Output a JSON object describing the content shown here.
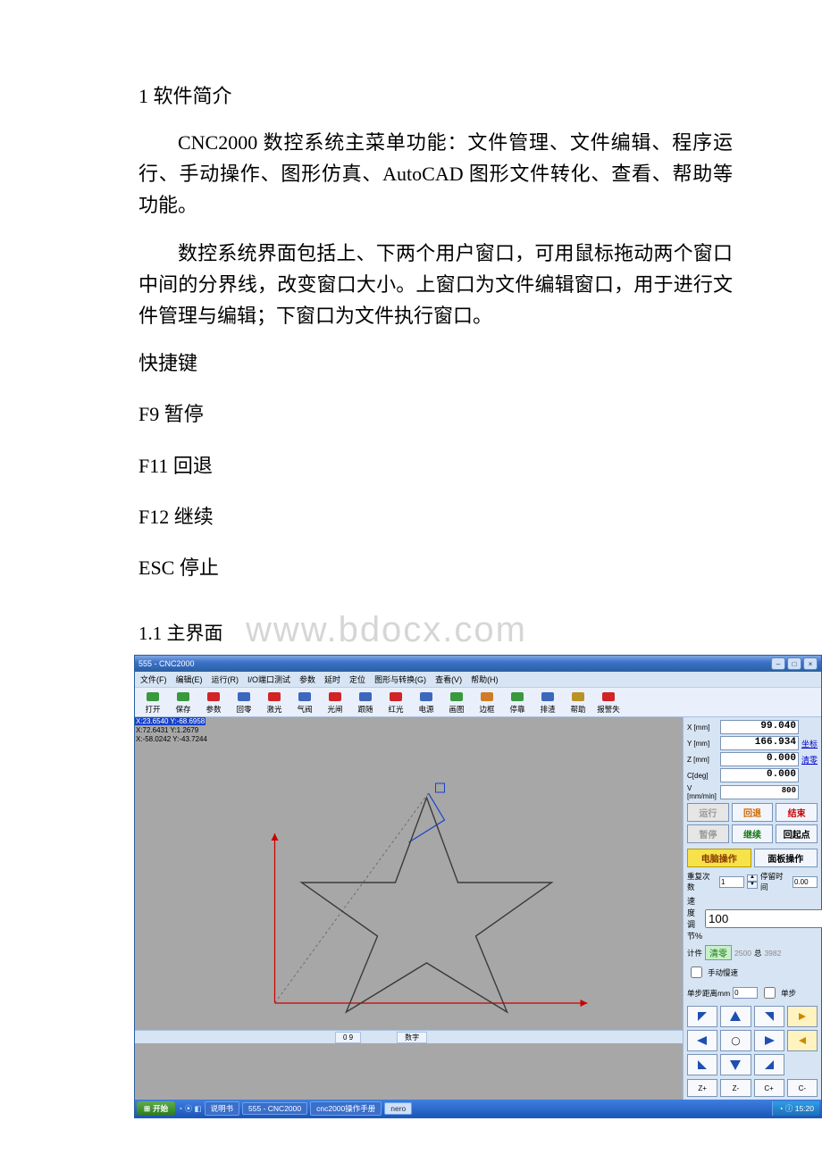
{
  "doc": {
    "h1": "1 软件简介",
    "p1": "CNC2000 数控系统主菜单功能：文件管理、文件编辑、程序运行、手动操作、图形仿真、AutoCAD 图形文件转化、查看、帮助等功能。",
    "p2": "数控系统界面包括上、下两个用户窗口，可用鼠标拖动两个窗口中间的分界线，改变窗口大小。上窗口为文件编辑窗口，用于进行文件管理与编辑；下窗口为文件执行窗口。",
    "shortcut_heading": "快捷键",
    "sc1": "F9  暂停",
    "sc2": "F11 回退",
    "sc3": "F12 继续",
    "sc4": "ESC 停止",
    "h2": "1.1 主界面",
    "watermark": "www.bdocx.com"
  },
  "app": {
    "title": "555 - CNC2000",
    "menus": [
      "文件(F)",
      "编辑(E)",
      "运行(R)",
      "I/O端口测试",
      "参数",
      "延时",
      "定位",
      "图形与转换(G)",
      "查看(V)",
      "帮助(H)"
    ],
    "tools": [
      {
        "id": "open",
        "label": "打开",
        "color": "#1a8a1a"
      },
      {
        "id": "save",
        "label": "保存",
        "color": "#1a8a1a"
      },
      {
        "id": "params",
        "label": "参数",
        "color": "#cc0000"
      },
      {
        "id": "origin",
        "label": "回零",
        "color": "#1e4fb1"
      },
      {
        "id": "laser",
        "label": "激光",
        "color": "#cc0000"
      },
      {
        "id": "air",
        "label": "气阀",
        "color": "#1e4fb1"
      },
      {
        "id": "light",
        "label": "光闸",
        "color": "#cc0000"
      },
      {
        "id": "follow",
        "label": "跟随",
        "color": "#1e4fb1"
      },
      {
        "id": "red",
        "label": "红光",
        "color": "#cc0000"
      },
      {
        "id": "power",
        "label": "电源",
        "color": "#1e4fb1"
      },
      {
        "id": "draw",
        "label": "画图",
        "color": "#1a8a1a"
      },
      {
        "id": "frame",
        "label": "边框",
        "color": "#cc6600"
      },
      {
        "id": "pause",
        "label": "停靠",
        "color": "#1a8a1a"
      },
      {
        "id": "slag",
        "label": "排渣",
        "color": "#1e4fb1"
      },
      {
        "id": "help",
        "label": "帮助",
        "color": "#b08000"
      },
      {
        "id": "alarm",
        "label": "报警失",
        "color": "#cc0000"
      }
    ],
    "coords": {
      "line1": "X:23.6540 Y:-68.6958",
      "line2": "X:72.6431 Y:1.2679",
      "line3": "X:-58.0242 Y:-43.7244"
    },
    "readouts": {
      "x_label": "X [mm]",
      "x_val": "99.040",
      "y_label": "Y [mm]",
      "y_val": "166.934",
      "z_label": "Z [mm]",
      "z_val": "0.000",
      "c_label": "C[deg]",
      "c_val": "0.000",
      "v_label": "V [mm/min]",
      "v_val": "800",
      "coord_btn": "坐标",
      "zero_btn": "清零"
    },
    "buttons": {
      "run": "运行",
      "back": "回退",
      "end": "结束",
      "pause": "暂停",
      "cont": "继续",
      "home": "回起点",
      "pc_op": "电脑操作",
      "panel_op": "面板操作"
    },
    "params": {
      "repeat_label": "重复次数",
      "repeat_val": "1",
      "dwell_label": "停留时间",
      "dwell_val": "0.00",
      "spd_label": "速度调节%",
      "spd_val": "100",
      "count_label": "计件",
      "clear_btn": "清零",
      "count_cur": "2500",
      "count_total_label": "总",
      "count_total": "3982",
      "slow_check": "手动慢速",
      "step_label": "单步距离mm",
      "step_val": "0",
      "single_check": "单步"
    },
    "axis_buttons": [
      "Z+",
      "Z-",
      "C+",
      "C-"
    ],
    "status": {
      "left": "0  9",
      "right": "数字"
    },
    "taskbar": {
      "start": "开始",
      "items": [
        "说明书",
        "555 - CNC2000",
        "cnc2000操作手册"
      ],
      "ime": "nero",
      "clock": "15:20"
    }
  }
}
